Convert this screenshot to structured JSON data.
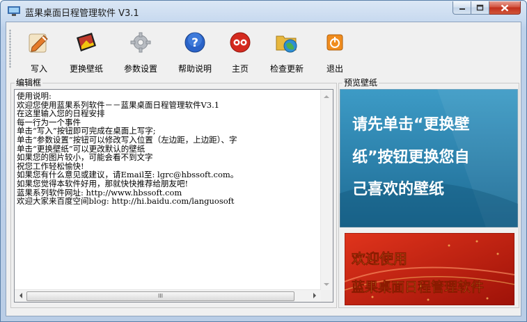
{
  "window": {
    "title": "蓝果桌面日程管理软件 V3.1"
  },
  "toolbar": {
    "items": [
      {
        "label": "写入",
        "icon": "write-icon"
      },
      {
        "label": "更换壁纸",
        "icon": "wallpaper-icon"
      },
      {
        "label": "参数设置",
        "icon": "settings-gear-icon"
      },
      {
        "label": "帮助说明",
        "icon": "help-icon"
      },
      {
        "label": "主页",
        "icon": "home-icon"
      },
      {
        "label": "检查更新",
        "icon": "update-icon"
      },
      {
        "label": "退出",
        "icon": "exit-icon"
      }
    ]
  },
  "editor": {
    "group_label": "编辑框",
    "text": "使用说明:\n欢迎您使用蓝果系列软件－－蓝果桌面日程管理软件V3.1\n在这里输入您的日程安排\n每一行为一个事件\n单击“写入”按钮即可完成在桌面上写字;\n单击“参数设置”按钮可以修改写入位置（左边距，上边距）、字\n单击“更换壁纸”可以更改默认的壁纸\n如果您的图片较小，可能会看不到文字\n祝您工作轻松愉快!\n如果您有什么意见或建议，请Email至: lgrc@hbssoft.com。\n如果您觉得本软件好用，那就快快推荐给朋友吧!\n蓝果系列软件网址: http://www.hbssoft.com\n欢迎大家来百度空间blog: http://hi.baidu.com/languosoft",
    "hscroll_grip": "III"
  },
  "preview": {
    "group_label": "预览壁纸",
    "message": [
      "请先单击“更换壁",
      "纸”按钮更换您自",
      "己喜欢的壁纸"
    ],
    "banner_line1": "欢迎使用",
    "banner_line2": "蓝果桌面日程管理软件"
  },
  "colors": {
    "preview_bg": "#2a7fa6",
    "banner_bg": "#c3200f",
    "banner_text": "#ffe84a"
  }
}
